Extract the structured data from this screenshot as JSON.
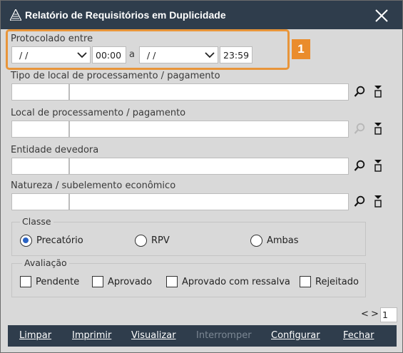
{
  "window": {
    "title": "Relatório de Requisitórios em Duplicidade",
    "close_label": "✕"
  },
  "callout": {
    "number": "1",
    "color": "#ea8c2c"
  },
  "protocolado": {
    "label": "Protocolado entre",
    "date_from": "/ /",
    "time_from": "00:00",
    "separator": "a",
    "date_to": "/ /",
    "time_to": "23:59"
  },
  "tipo_local": {
    "label": "Tipo de local de processamento / pagamento",
    "code": "",
    "description": ""
  },
  "local": {
    "label": "Local de processamento / pagamento",
    "code": "",
    "description": "",
    "search_disabled": true
  },
  "entidade": {
    "label": "Entidade devedora",
    "code": "",
    "description": ""
  },
  "natureza": {
    "label": "Natureza / subelemento econômico",
    "code": "",
    "description": ""
  },
  "classe": {
    "label": "Classe",
    "options": [
      "Precatório",
      "RPV",
      "Ambas"
    ],
    "selected": "Precatório"
  },
  "avaliacao": {
    "label": "Avaliação",
    "options": [
      "Pendente",
      "Aprovado",
      "Aprovado com ressalva",
      "Rejeitado"
    ],
    "checked": []
  },
  "pager": {
    "prev": "<",
    "next": ">",
    "page": "1"
  },
  "footer": {
    "buttons": [
      "Limpar",
      "Imprimir",
      "Visualizar",
      "Interromper",
      "Configurar",
      "Fechar"
    ],
    "disabled": [
      "Interromper"
    ]
  },
  "colors": {
    "titlebar": "#2f3d4c",
    "background": "#d9d9d9",
    "accent": "#ea8c2c",
    "radio_selected": "#2a63c4"
  }
}
